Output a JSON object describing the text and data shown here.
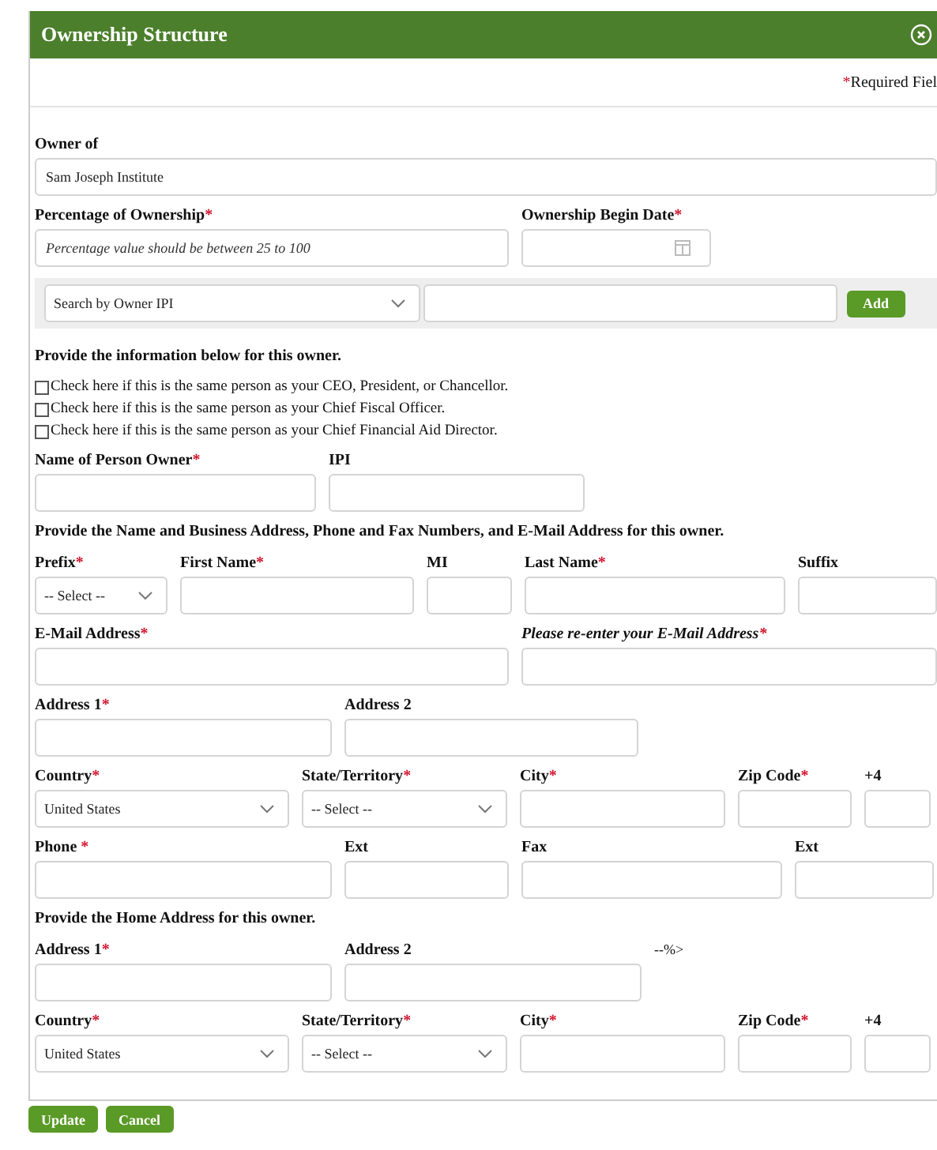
{
  "dialog": {
    "title": "Ownership Structure"
  },
  "required_note": {
    "mark": "*",
    "text": "Required Fiel"
  },
  "rows": [
    {
      "kind": "fields",
      "fields": [
        {
          "label": "Owner of",
          "kind": "text",
          "value": "Sam Joseph Institute"
        }
      ]
    },
    {
      "kind": "fields",
      "fields": [
        {
          "label": "Percentage of Ownership",
          "required_mark": "*",
          "kind": "text",
          "placeholder": "Percentage value should be between 25 to 100"
        },
        {
          "label": "Ownership Begin Date",
          "required_mark": "*",
          "kind": "date"
        }
      ]
    },
    {
      "kind": "search",
      "select": "Search by Owner IPI",
      "button": "Add"
    },
    {
      "kind": "heading",
      "text": "Provide the information below for this owner."
    },
    {
      "kind": "checkbox",
      "label": "Check here if this is the same person as your CEO, President, or Chancellor.",
      "checked": false
    },
    {
      "kind": "checkbox",
      "label": "Check here if this is the same person as your Chief Fiscal Officer.",
      "checked": false
    },
    {
      "kind": "checkbox",
      "label": "Check here if this is the same person as your Chief Financial Aid Director.",
      "checked": false
    },
    {
      "kind": "fields",
      "fields": [
        {
          "label": "Name of Person Owner",
          "required_mark": "*",
          "kind": "text"
        },
        {
          "label": "IPI",
          "kind": "text"
        }
      ]
    },
    {
      "kind": "heading",
      "text": "Provide the Name and Business Address, Phone and Fax Numbers, and E-Mail Address for this owner."
    },
    {
      "kind": "fields",
      "fields": [
        {
          "label": "Prefix",
          "required_mark": "*",
          "kind": "select",
          "value": "-- Select --"
        },
        {
          "label": "First Name",
          "required_mark": "*",
          "kind": "text"
        },
        {
          "label": "MI",
          "kind": "text"
        },
        {
          "label": "Last Name",
          "required_mark": "*",
          "kind": "text"
        },
        {
          "label": "Suffix",
          "kind": "text"
        }
      ]
    },
    {
      "kind": "fields",
      "fields": [
        {
          "label": "E-Mail Address",
          "required_mark": "*",
          "kind": "text"
        },
        {
          "label": "Please re-enter your E-Mail Address",
          "label_italic": true,
          "required_mark": "*",
          "kind": "text"
        }
      ]
    },
    {
      "kind": "fields",
      "fields": [
        {
          "label": "Address 1",
          "required_mark": "*",
          "kind": "text"
        },
        {
          "label": "Address 2",
          "kind": "text"
        }
      ]
    },
    {
      "kind": "fields",
      "fields": [
        {
          "label": "Country",
          "required_mark": "*",
          "kind": "select",
          "value": "United States"
        },
        {
          "label": "State/Territory",
          "required_mark": "*",
          "kind": "select",
          "value": "-- Select --"
        },
        {
          "label": "City",
          "required_mark": "*",
          "kind": "text"
        },
        {
          "label": "Zip Code",
          "required_mark": "*",
          "kind": "text"
        },
        {
          "label": "+4",
          "kind": "text"
        }
      ]
    },
    {
      "kind": "fields",
      "fields": [
        {
          "label": "Phone ",
          "required_mark": "*",
          "kind": "text"
        },
        {
          "label": "Ext",
          "kind": "text"
        },
        {
          "label": "Fax",
          "kind": "text"
        },
        {
          "label": "Ext",
          "kind": "text"
        }
      ]
    },
    {
      "kind": "heading",
      "text": "Provide the Home Address for this owner."
    },
    {
      "kind": "fields",
      "note": "--%>",
      "fields": [
        {
          "label": "Address 1",
          "required_mark": "*",
          "kind": "text"
        },
        {
          "label": "Address 2",
          "kind": "text"
        }
      ]
    },
    {
      "kind": "fields",
      "fields": [
        {
          "label": "Country",
          "required_mark": "*",
          "kind": "select",
          "value": "United States"
        },
        {
          "label": "State/Territory",
          "required_mark": "*",
          "kind": "select",
          "value": "-- Select --"
        },
        {
          "label": "City",
          "required_mark": "*",
          "kind": "text"
        },
        {
          "label": "Zip Code",
          "required_mark": "*",
          "kind": "text"
        },
        {
          "label": "+4",
          "kind": "text"
        }
      ]
    }
  ],
  "buttons": [
    "Update",
    "Cancel"
  ]
}
